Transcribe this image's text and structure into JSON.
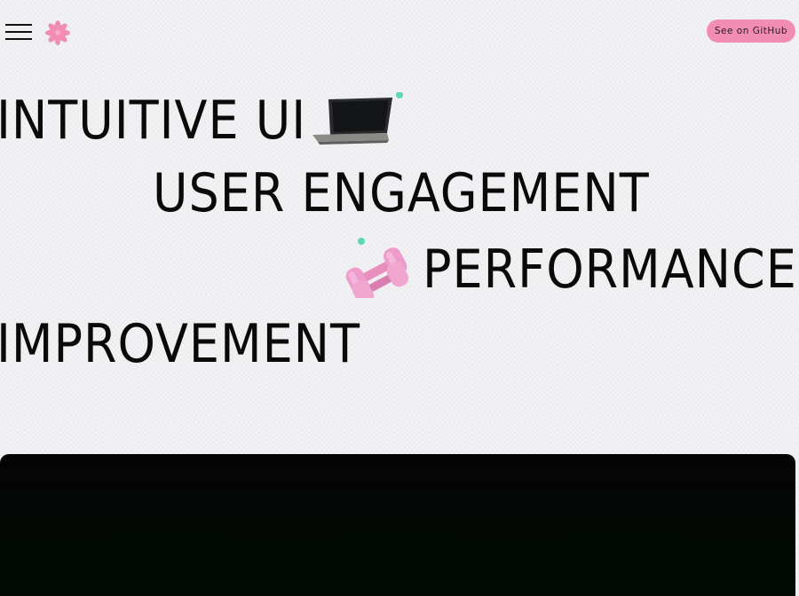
{
  "header": {
    "menu_icon": "hamburger-menu-icon",
    "logo_icon": "asterisk-flower-icon",
    "github_button_label": "See on GitHub",
    "accent_color": "#f28db2"
  },
  "hero": {
    "lines": [
      "INTUITIVE UI",
      "USER ENGAGEMENT",
      "PERFORMANCE",
      "IMPROVEMENT"
    ],
    "decorations": [
      "laptop-icon",
      "dumbbell-icon"
    ],
    "dot_color": "#5fd6b4"
  },
  "panel": {
    "background": "#020604"
  }
}
